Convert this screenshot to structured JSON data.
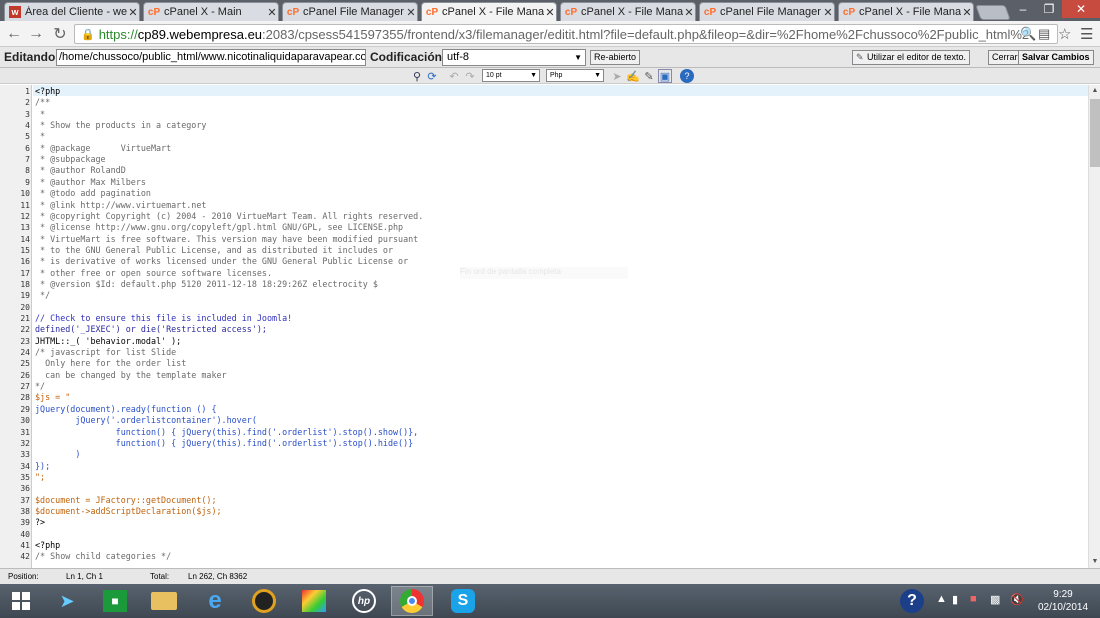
{
  "tabs": [
    {
      "icon": "w",
      "title": "Área del Cliente - web",
      "active": false
    },
    {
      "icon": "cP",
      "title": "cPanel X - Main",
      "active": false
    },
    {
      "icon": "cP",
      "title": "cPanel File Manager v",
      "active": false
    },
    {
      "icon": "cP",
      "title": "cPanel X - File Manag",
      "active": true
    },
    {
      "icon": "cP",
      "title": "cPanel X - File Manag",
      "active": false
    },
    {
      "icon": "cP",
      "title": "cPanel File Manager v",
      "active": false
    },
    {
      "icon": "cP",
      "title": "cPanel X - File Manag",
      "active": false
    }
  ],
  "window": {
    "minimize": "–",
    "maximize": "❐",
    "close": "✕"
  },
  "address": {
    "scheme": "https://",
    "host": "cp89.webempresa.eu",
    "path": ":2083/cpsess541597355/frontend/x3/filemanager/editit.html?file=default.php&fileop=&dir=%2Fhome%2Fchussoco%2Fpublic_html%2"
  },
  "editbar": {
    "editing_label": "Editando:",
    "path_value": "/home/chussoco/public_html/www.nicotinaliquidaparavapear.com",
    "encoding_label": "Codificación:",
    "encoding_value": "utf-8",
    "reopen_label": "Re-abierto",
    "text_editor_label": "Utilizar el editor de texto.",
    "close_label": "Cerrar",
    "save_label": "Salvar Cambios"
  },
  "toolbar": {
    "font_size": "10 pt",
    "syntax": "Php"
  },
  "editor": {
    "ghost_text": "Fin ord de pantalla completa",
    "lines": [
      {
        "n": "1",
        "t": "<?php",
        "c": "php"
      },
      {
        "n": "2",
        "t": "/**",
        "c": "com"
      },
      {
        "n": "3",
        "t": " *",
        "c": "com"
      },
      {
        "n": "4",
        "t": " * Show the products in a category",
        "c": "com"
      },
      {
        "n": "5",
        "t": " *",
        "c": "com"
      },
      {
        "n": "6",
        "t": " * @package      VirtueMart",
        "c": "com"
      },
      {
        "n": "7",
        "t": " * @subpackage",
        "c": "com"
      },
      {
        "n": "8",
        "t": " * @author RolandD",
        "c": "com"
      },
      {
        "n": "9",
        "t": " * @author Max Milbers",
        "c": "com"
      },
      {
        "n": "10",
        "t": " * @todo add pagination",
        "c": "com"
      },
      {
        "n": "11",
        "t": " * @link http://www.virtuemart.net",
        "c": "com"
      },
      {
        "n": "12",
        "t": " * @copyright Copyright (c) 2004 - 2010 VirtueMart Team. All rights reserved.",
        "c": "com"
      },
      {
        "n": "13",
        "t": " * @license http://www.gnu.org/copyleft/gpl.html GNU/GPL, see LICENSE.php",
        "c": "com"
      },
      {
        "n": "14",
        "t": " * VirtueMart is free software. This version may have been modified pursuant",
        "c": "com"
      },
      {
        "n": "15",
        "t": " * to the GNU General Public License, and as distributed it includes or",
        "c": "com"
      },
      {
        "n": "16",
        "t": " * is derivative of works licensed under the GNU General Public License or",
        "c": "com"
      },
      {
        "n": "17",
        "t": " * other free or open source software licenses.",
        "c": "com"
      },
      {
        "n": "18",
        "t": " * @version $Id: default.php 5120 2011-12-18 18:29:26Z electrocity $",
        "c": "com"
      },
      {
        "n": "19",
        "t": " */",
        "c": "com"
      },
      {
        "n": "20",
        "t": "",
        "c": "def"
      },
      {
        "n": "21",
        "t": "// Check to ensure this file is included in Joomla!",
        "c": "blue"
      },
      {
        "n": "22",
        "t": "defined('_JEXEC') or die('Restricted access');",
        "c": "fn"
      },
      {
        "n": "23",
        "t": "JHTML::_( 'behavior.modal' );",
        "c": "def"
      },
      {
        "n": "24",
        "t": "/* javascript for list Slide",
        "c": "com"
      },
      {
        "n": "25",
        "t": "  Only here for the order list",
        "c": "com"
      },
      {
        "n": "26",
        "t": "  can be changed by the template maker",
        "c": "com"
      },
      {
        "n": "27",
        "t": "*/",
        "c": "com"
      },
      {
        "n": "28",
        "t": "$js = \"",
        "c": "var"
      },
      {
        "n": "29",
        "t": "jQuery(document).ready(function () {",
        "c": "str"
      },
      {
        "n": "30",
        "t": "        jQuery('.orderlistcontainer').hover(",
        "c": "str"
      },
      {
        "n": "31",
        "t": "                function() { jQuery(this).find('.orderlist').stop().show()},",
        "c": "str"
      },
      {
        "n": "32",
        "t": "                function() { jQuery(this).find('.orderlist').stop().hide()}",
        "c": "str"
      },
      {
        "n": "33",
        "t": "        )",
        "c": "str"
      },
      {
        "n": "34",
        "t": "});",
        "c": "str"
      },
      {
        "n": "35",
        "t": "\";",
        "c": "var"
      },
      {
        "n": "36",
        "t": "",
        "c": "def"
      },
      {
        "n": "37",
        "t": "$document = JFactory::getDocument();",
        "c": "var"
      },
      {
        "n": "38",
        "t": "$document->addScriptDeclaration($js);",
        "c": "var"
      },
      {
        "n": "39",
        "t": "?>",
        "c": "php"
      },
      {
        "n": "40",
        "t": "",
        "c": "def"
      },
      {
        "n": "41",
        "t": "<?php",
        "c": "php"
      },
      {
        "n": "42",
        "t": "/* Show child categories */",
        "c": "com"
      }
    ]
  },
  "status": {
    "position_label": "Position:",
    "position_value": "Ln 1, Ch 1",
    "total_label": "Total:",
    "total_value": "Ln 262, Ch 8362"
  },
  "taskbar": {
    "time": "9:29",
    "date": "02/10/2014",
    "apps": [
      "start-icon",
      "rocket-icon",
      "store-icon",
      "explorer-icon",
      "ie-icon",
      "media-icon",
      "photo-icon",
      "hp-icon",
      "chrome-icon",
      "skype-icon"
    ]
  },
  "colors": {
    "accent": "#ff6c2c",
    "https": "#2a8a2a",
    "taskbar": "#4a535d"
  }
}
